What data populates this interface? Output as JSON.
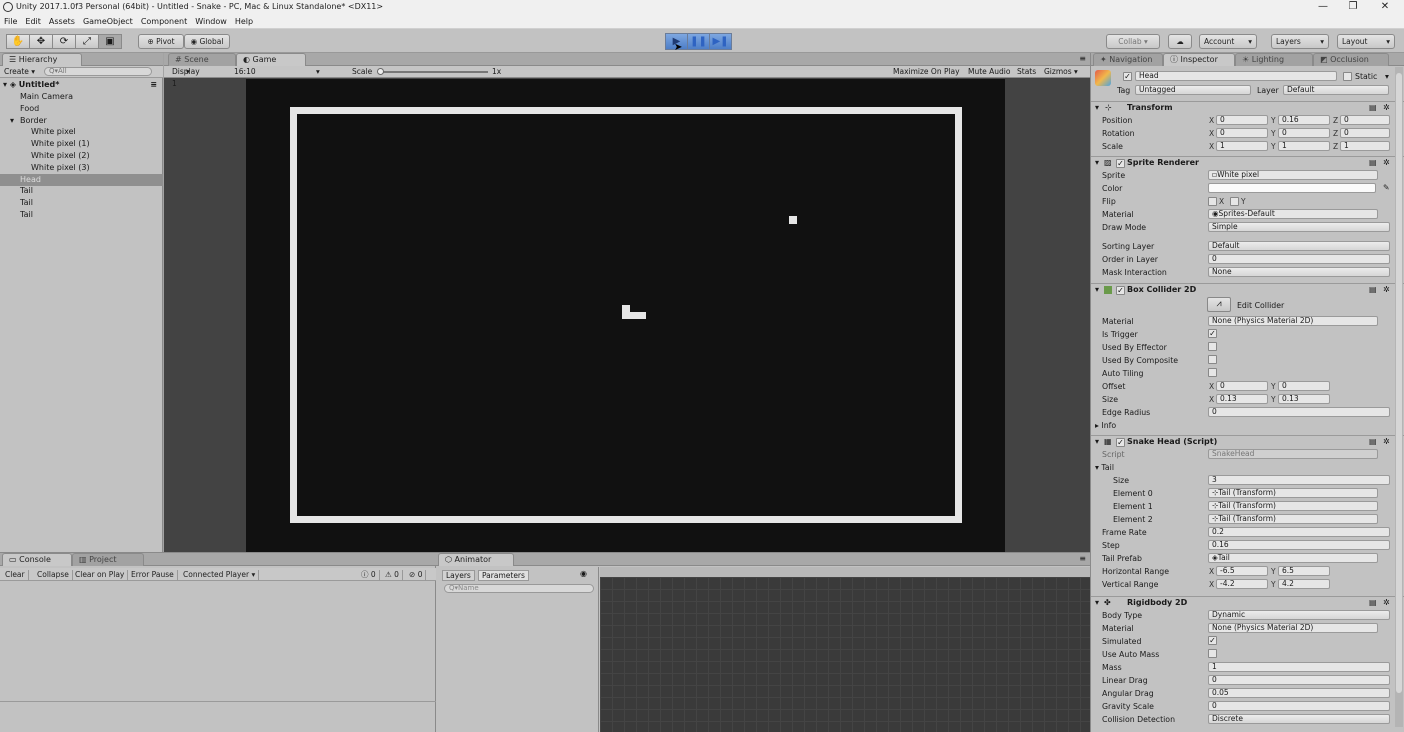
{
  "window": {
    "title": "Unity 2017.1.0f3 Personal (64bit) - Untitled - Snake - PC, Mac & Linux Standalone* <DX11>",
    "minimize": "—",
    "restore": "❐",
    "close": "✕"
  },
  "menu": [
    "File",
    "Edit",
    "Assets",
    "GameObject",
    "Component",
    "Window",
    "Help"
  ],
  "toolbar": {
    "tools": [
      "✋",
      "✥",
      "⟳",
      "⤢",
      "▣"
    ],
    "pivot": "Pivot",
    "global": "Global",
    "play": "▶",
    "pause": "❚❚",
    "step": "▶❚",
    "collab": "Collab ▾",
    "cloud": "☁",
    "account": "Account",
    "layers": "Layers",
    "layout": "Layout"
  },
  "hierarchy": {
    "tab": "Hierarchy",
    "create": "Create ▾",
    "search_placeholder": "Q▾All",
    "scene": "Untitled*",
    "items": [
      {
        "label": "Main Camera",
        "depth": 1
      },
      {
        "label": "Food",
        "depth": 1
      },
      {
        "label": "Border",
        "depth": 1
      },
      {
        "label": "White pixel",
        "depth": 2
      },
      {
        "label": "White pixel (1)",
        "depth": 2
      },
      {
        "label": "White pixel (2)",
        "depth": 2
      },
      {
        "label": "White pixel (3)",
        "depth": 2
      },
      {
        "label": "Head",
        "depth": 1
      },
      {
        "label": "Tail",
        "depth": 1
      },
      {
        "label": "Tail",
        "depth": 1
      },
      {
        "label": "Tail",
        "depth": 1
      }
    ]
  },
  "gameview": {
    "tab_scene": "Scene",
    "tab_game": "Game",
    "display": "Display 1",
    "aspect": "16:10",
    "scale_label": "Scale",
    "scale_value": "1x",
    "maximize": "Maximize On Play",
    "mute": "Mute Audio",
    "stats": "Stats",
    "gizmos": "Gizmos ▾"
  },
  "inspector": {
    "tabs": [
      "Navigation",
      "Inspector",
      "Lighting",
      "Occlusion"
    ],
    "object_name": "Head",
    "static_label": "Static",
    "tag_label": "Tag",
    "tag_value": "Untagged",
    "layer_label": "Layer",
    "layer_value": "Default",
    "transform": {
      "title": "Transform",
      "position_label": "Position",
      "position": [
        "0",
        "0.16",
        "0"
      ],
      "rotation_label": "Rotation",
      "rotation": [
        "0",
        "0",
        "0"
      ],
      "scale_label": "Scale",
      "scale": [
        "1",
        "1",
        "1"
      ]
    },
    "sprite_renderer": {
      "title": "Sprite Renderer",
      "sprite_label": "Sprite",
      "sprite": "White pixel",
      "color_label": "Color",
      "flip_label": "Flip",
      "flip_x": "X",
      "flip_y": "Y",
      "material_label": "Material",
      "material": "Sprites-Default",
      "drawmode_label": "Draw Mode",
      "drawmode": "Simple",
      "sorting_label": "Sorting Layer",
      "sorting": "Default",
      "order_label": "Order in Layer",
      "order": "0",
      "mask_label": "Mask Interaction",
      "mask": "None"
    },
    "box_collider": {
      "title": "Box Collider 2D",
      "edit": "Edit Collider",
      "material_label": "Material",
      "material": "None (Physics Material 2D)",
      "trigger_label": "Is Trigger",
      "effector_label": "Used By Effector",
      "composite_label": "Used By Composite",
      "tiling_label": "Auto Tiling",
      "offset_label": "Offset",
      "offset": [
        "0",
        "0"
      ],
      "size_label": "Size",
      "size": [
        "0.13",
        "0.13"
      ],
      "edge_label": "Edge Radius",
      "edge": "0",
      "info_label": "Info"
    },
    "snake_head": {
      "title": "Snake Head (Script)",
      "script_label": "Script",
      "script": "SnakeHead",
      "tail_label": "Tail",
      "size_label": "Size",
      "size": "3",
      "e0_label": "Element 0",
      "e0": "Tail (Transform)",
      "e1_label": "Element 1",
      "e1": "Tail (Transform)",
      "e2_label": "Element 2",
      "e2": "Tail (Transform)",
      "framerate_label": "Frame Rate",
      "framerate": "0.2",
      "step_label": "Step",
      "step": "0.16",
      "prefab_label": "Tail Prefab",
      "prefab": "Tail",
      "hrange_label": "Horizontal Range",
      "hrange": [
        "-6.5",
        "6.5"
      ],
      "vrange_label": "Vertical Range",
      "vrange": [
        "-4.2",
        "4.2"
      ]
    },
    "rigidbody": {
      "title": "Rigidbody 2D",
      "bodytype_label": "Body Type",
      "bodytype": "Dynamic",
      "material_label": "Material",
      "material": "None (Physics Material 2D)",
      "simulated_label": "Simulated",
      "automass_label": "Use Auto Mass",
      "mass_label": "Mass",
      "mass": "1",
      "ldrag_label": "Linear Drag",
      "ldrag": "0",
      "adrag_label": "Angular Drag",
      "adrag": "0.05",
      "gravity_label": "Gravity Scale",
      "gravity": "0",
      "collision_label": "Collision Detection",
      "collision": "Discrete"
    }
  },
  "console": {
    "tab_console": "Console",
    "tab_project": "Project",
    "buttons": [
      "Clear",
      "Collapse",
      "Clear on Play",
      "Error Pause",
      "Connected Player ▾"
    ],
    "counts": [
      "0",
      "0",
      "0"
    ]
  },
  "animator": {
    "tab": "Animator",
    "layers": "Layers",
    "parameters": "Parameters",
    "search_placeholder": "Q▾Name"
  },
  "colors": {
    "editor_bg": "#c2c2c2",
    "game_bg": "#111111",
    "border_white": "#e8e8e8",
    "play_active": "#4d7ec8"
  }
}
